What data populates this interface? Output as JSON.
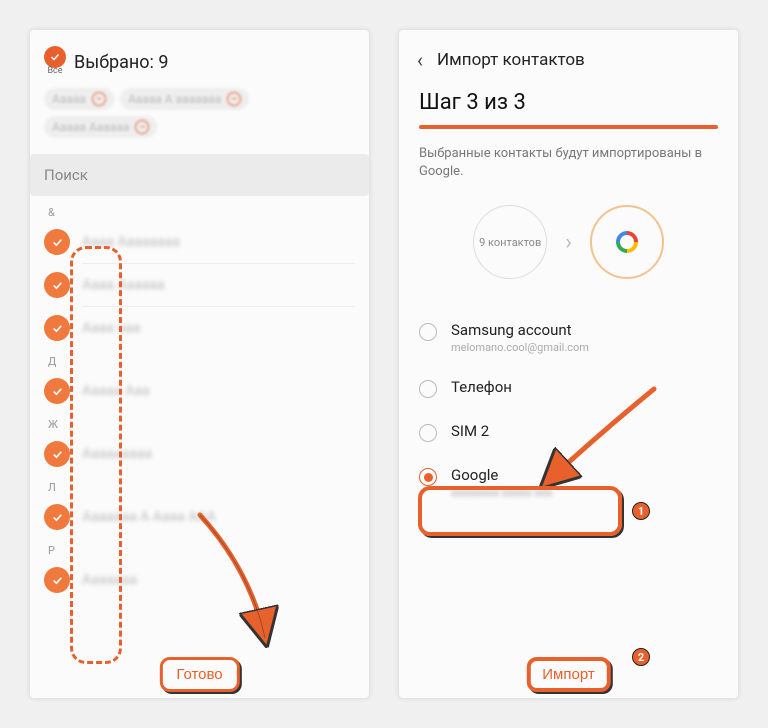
{
  "left": {
    "allLabel": "Все",
    "selectedText": "Выбрано: 9",
    "chips": [
      "Ааааа",
      "Ааааа А ааааааа",
      "Ааааа Аааааа"
    ],
    "searchPlaceholder": "Поиск",
    "sections": [
      {
        "letter": "&",
        "items": [
          "Аааа Аааааааа",
          "Аааа Аааааа",
          "Аааа ааа"
        ]
      },
      {
        "letter": "Д",
        "items": [
          "Ааааа Ааа"
        ]
      },
      {
        "letter": "Ж",
        "items": [
          "Ааааааааа"
        ]
      },
      {
        "letter": "Л",
        "items": [
          "Ааааааа А Аааа ААА"
        ]
      },
      {
        "letter": "Р",
        "items": [
          "Ааааааа"
        ]
      }
    ],
    "doneButton": "Готово"
  },
  "right": {
    "headerTitle": "Импорт контактов",
    "stepTitle": "Шаг 3 из 3",
    "stepDesc": "Выбранные контакты будут импортированы в Google.",
    "contactsCircle": "9 контактов",
    "options": [
      {
        "label": "Samsung account",
        "sub": "melomano.cool@gmail.com",
        "selected": false
      },
      {
        "label": "Телефон",
        "sub": "",
        "selected": false
      },
      {
        "label": "SIM 2",
        "sub": "",
        "selected": false
      },
      {
        "label": "Google",
        "sub": "аааааааа ааааа ааа",
        "selected": true
      }
    ],
    "importButton": "Импорт"
  }
}
